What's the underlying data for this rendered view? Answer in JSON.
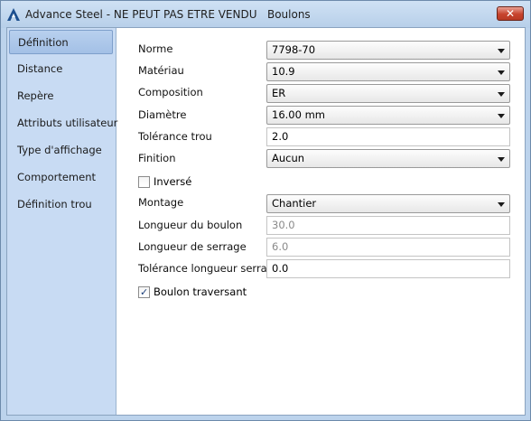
{
  "window": {
    "title": "Advance Steel - NE PEUT PAS ETRE VENDU   Boulons",
    "close_label": "✕"
  },
  "sidebar": {
    "items": [
      {
        "label": "Définition"
      },
      {
        "label": "Distance"
      },
      {
        "label": "Repère"
      },
      {
        "label": "Attributs utilisateur"
      },
      {
        "label": "Type d'affichage"
      },
      {
        "label": "Comportement"
      },
      {
        "label": "Définition trou"
      }
    ],
    "selected": "Définition"
  },
  "form": {
    "norme": {
      "label": "Norme",
      "value": "7798-70"
    },
    "materiau": {
      "label": "Matériau",
      "value": "10.9"
    },
    "composition": {
      "label": "Composition",
      "value": "ER"
    },
    "diametre": {
      "label": "Diamètre",
      "value": "16.00 mm"
    },
    "tolerance_trou": {
      "label": "Tolérance trou",
      "value": "2.0"
    },
    "finition": {
      "label": "Finition",
      "value": "Aucun"
    },
    "inverse": {
      "label": "Inversé",
      "checked": false
    },
    "montage": {
      "label": "Montage",
      "value": "Chantier"
    },
    "longueur_boulon": {
      "label": "Longueur du boulon",
      "value": "30.0"
    },
    "longueur_serrage": {
      "label": "Longueur de serrage",
      "value": "6.0"
    },
    "tolerance_longueur_serrage": {
      "label": "Tolérance longueur serrage",
      "value": "0.0"
    },
    "boulon_traversant": {
      "label": "Boulon traversant",
      "checked": true,
      "checkmark": "✓"
    }
  },
  "colors": {
    "title_bar": "#bcd3ec",
    "sidebar": "#c8dbf3",
    "close_button": "#c7432d"
  }
}
